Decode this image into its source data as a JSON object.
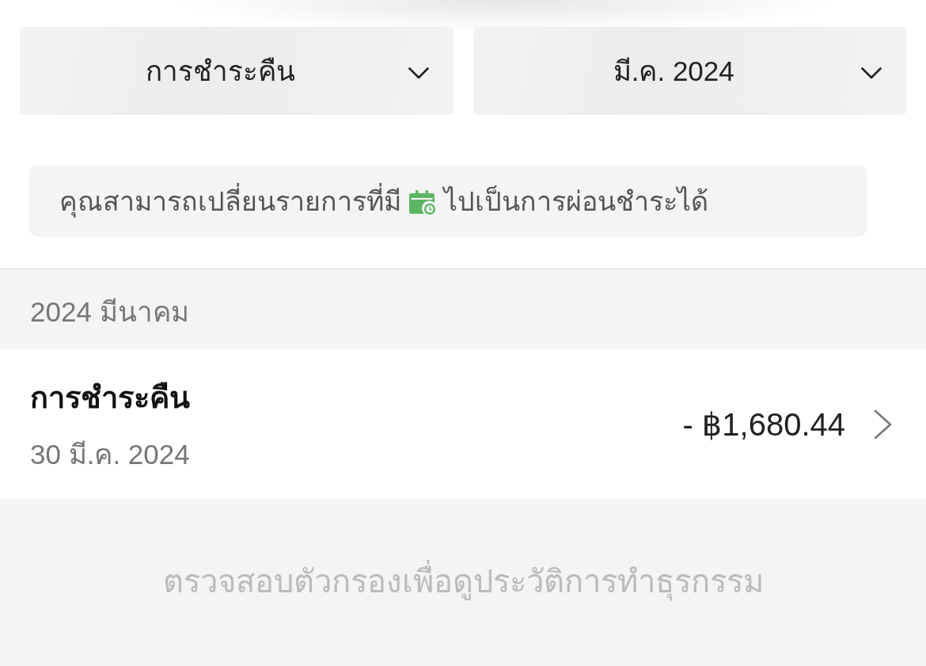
{
  "filters": [
    {
      "value": "การชำระคืน"
    },
    {
      "value": "มี.ค. 2024"
    }
  ],
  "info_banner": {
    "text_before": "คุณสามารถเปลี่ยนรายการที่มี",
    "text_after": "ไปเป็นการผ่อนชำระได้"
  },
  "sections": [
    {
      "header": "2024 มีนาคม",
      "transactions": [
        {
          "title": "การชำระคืน",
          "date": "30 มี.ค. 2024",
          "amount": "- ฿1,680.44"
        }
      ]
    }
  ],
  "footer_note": "ตรวจสอบตัวกรองเพื่อดูประวัติการทำธุรกรรม"
}
